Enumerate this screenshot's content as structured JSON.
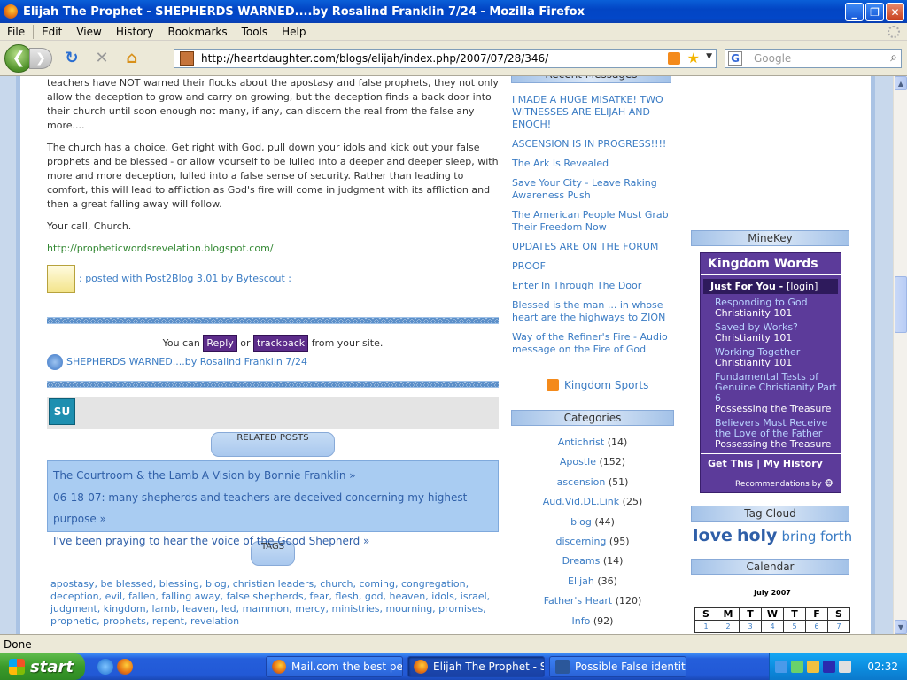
{
  "window": {
    "title": "Elijah The Prophet - SHEPHERDS WARNED....by Rosalind Franklin 7/24 - Mozilla Firefox",
    "minimize_label": "_",
    "maximize_label": "❐",
    "close_label": "✕"
  },
  "menu": {
    "items": [
      "File",
      "Edit",
      "View",
      "History",
      "Bookmarks",
      "Tools",
      "Help"
    ]
  },
  "nav": {
    "back_glyph": "❮",
    "forward_glyph": "❯",
    "reload_glyph": "↻",
    "stop_glyph": "✕",
    "home_glyph": "⌂",
    "url": "http://heartdaughter.com/blogs/elijah/index.php/2007/07/28/346/",
    "search_placeholder": "Google"
  },
  "post": {
    "paragraph1": "teachers have NOT warned their flocks about the apostasy and false prophets, they not only allow the deception to grow and carry on growing, but the deception finds a back door into their church until soon enough not many, if any, can discern the real from the false any more....",
    "paragraph2": "The church has a choice. Get right with God, pull down your idols and kick out your false prophets and be blessed - or allow yourself to be lulled into a deeper and deeper sleep, with more and more deception, lulled into a false sense of security. Rather than leading to comfort, this will lead to affliction as God's fire will come in judgment with its affliction and then a great falling away will follow.",
    "paragraph3": "Your call, Church.",
    "link": "http://propheticwordsrevelation.blogspot.com/",
    "posted_with": ": posted with Post2Blog 3.01 by Bytescout :",
    "you_can": "You can",
    "reply_label": "Reply",
    "or": "or",
    "trackback_label": "trackback",
    "from_site": "from your site.",
    "post_title_link": "SHEPHERDS WARNED....by Rosalind Franklin 7/24",
    "stumble_label": "SU",
    "related_heading": "RELATED POSTS",
    "related": [
      "The Courtroom & the Lamb A Vision by Bonnie Franklin",
      "06-18-07: many shepherds and teachers are deceived concerning my highest purpose",
      "I've been praying to hear the voice of the Good Shepherd"
    ],
    "tags_heading": "TAGS",
    "tags_text": "apostasy, be blessed, blessing, blog, christian leaders, church, coming, congregation, deception, evil, fallen, falling away, false shepherds, fear, flesh, god, heaven, idols, israel, judgment, kingdom, lamb, leaven, led, mammon, mercy, ministries, mourning, promises, prophetic, prophets, repent, revelation"
  },
  "sidebar": {
    "recent_heading": "Recent Messages",
    "recent": [
      "I MADE A HUGE MISATKE! TWO WITNESSES ARE ELIJAH AND ENOCH!",
      "ASCENSION IS IN PROGRESS!!!!",
      "The Ark Is Revealed",
      "Save Your City - Leave Raking Awareness Push",
      "The American People Must Grab Their Freedom Now",
      "UPDATES ARE ON THE FORUM",
      "PROOF",
      "Enter In Through The Door",
      "Blessed is the man ... in whose heart are the highways to ZION",
      "Way of the Refiner's Fire - Audio message on the Fire of God"
    ],
    "kingdom_sports": "Kingdom Sports",
    "categories_heading": "Categories",
    "categories": [
      {
        "name": "Antichrist",
        "count": "(14)"
      },
      {
        "name": "Apostle",
        "count": "(152)"
      },
      {
        "name": "ascension",
        "count": "(51)"
      },
      {
        "name": "Aud.Vid.DL.Link",
        "count": "(25)"
      },
      {
        "name": "blog",
        "count": "(44)"
      },
      {
        "name": "discerning",
        "count": "(95)"
      },
      {
        "name": "Dreams",
        "count": "(14)"
      },
      {
        "name": "Elijah",
        "count": "(36)"
      },
      {
        "name": "Father's Heart",
        "count": "(120)"
      },
      {
        "name": "Info",
        "count": "(92)"
      }
    ]
  },
  "right": {
    "minekey_heading": "MineKey",
    "kw_title": "Kingdom Words",
    "kw_just_for_you": "Just For You -",
    "kw_login": "[login]",
    "kw_entries": [
      {
        "title": "Responding to God",
        "sub": "Christianity 101"
      },
      {
        "title": "Saved by Works?",
        "sub": "Christianity 101"
      },
      {
        "title": "Working Together",
        "sub": "Christianity 101"
      },
      {
        "title": "Fundamental Tests of Genuine Christianity Part 6",
        "sub": "Possessing the Treasure"
      },
      {
        "title": "Believers Must Receive the Love of the Father",
        "sub": "Possessing the Treasure"
      }
    ],
    "kw_get_this": "Get This",
    "kw_pipe": "|",
    "kw_history": "My History",
    "kw_recommend": "Recommendations by",
    "tagcloud_heading": "Tag Cloud",
    "tag_love": "love",
    "tag_holy": "holy",
    "tag_bring": "bring forth",
    "calendar_heading": "Calendar",
    "calendar_month": "July 2007",
    "calendar_days": [
      "S",
      "M",
      "T",
      "W",
      "T",
      "F",
      "S"
    ],
    "calendar_week1": [
      "1",
      "2",
      "3",
      "4",
      "5",
      "6",
      "7"
    ]
  },
  "status": {
    "text": "Done"
  },
  "taskbar": {
    "start_label": "start",
    "tasks": [
      "Mail.com the best per...",
      "Elijah The Prophet - S...",
      "Possible False identiti..."
    ],
    "clock": "02:32"
  }
}
